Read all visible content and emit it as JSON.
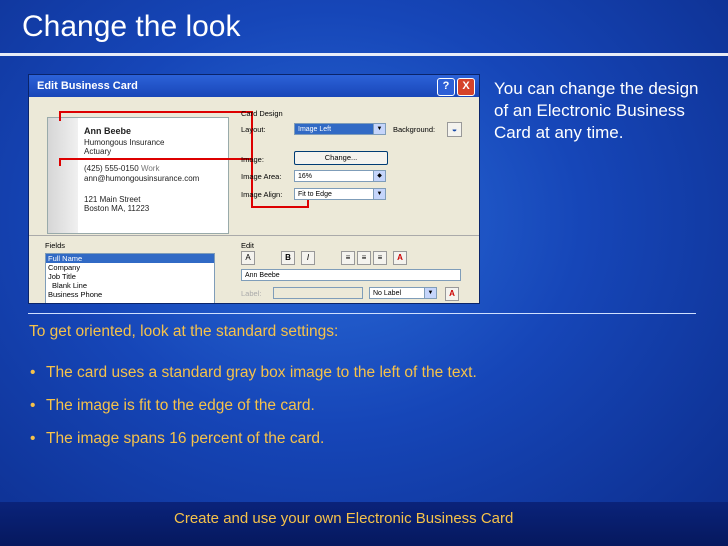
{
  "slide": {
    "title": "Change the look",
    "side_text": "You can change the design of an Electronic Business Card at any time.",
    "oriented": "To get oriented, look at the standard settings:",
    "bullets": [
      "The card uses a standard gray box image to the left of the text.",
      "The image is fit to the edge of the card.",
      "The image spans 16 percent of the card."
    ],
    "footer": "Create and use your own Electronic Business Card"
  },
  "dialog": {
    "title": "Edit Business Card",
    "help": "?",
    "close": "X",
    "card": {
      "name": "Ann Beebe",
      "company": "Humongous Insurance",
      "job": "Actuary",
      "phone": "(425) 555-0150",
      "phone_type": "Work",
      "email": "ann@humongousinsurance.com",
      "street": "121 Main Street",
      "city": "Boston MA, 11223"
    },
    "card_design_label": "Card Design",
    "layout_label": "Layout:",
    "layout_value": "Image Left",
    "background_label": "Background:",
    "image_label": "Image:",
    "change_button": "Change...",
    "image_area_label": "Image Area:",
    "image_area_value": "16%",
    "image_align_label": "Image Align:",
    "image_align_value": "Fit to Edge",
    "fields_label": "Fields",
    "fields": [
      "Full Name",
      "Company",
      "Job Title",
      "Blank Line",
      "Business Phone"
    ],
    "edit_label": "Edit",
    "edit_value": "Ann Beebe",
    "label_label": "Label:",
    "label_value": "No Label",
    "tools": [
      "A",
      "B",
      "I",
      "≡",
      "≡",
      "≡",
      "A"
    ]
  }
}
